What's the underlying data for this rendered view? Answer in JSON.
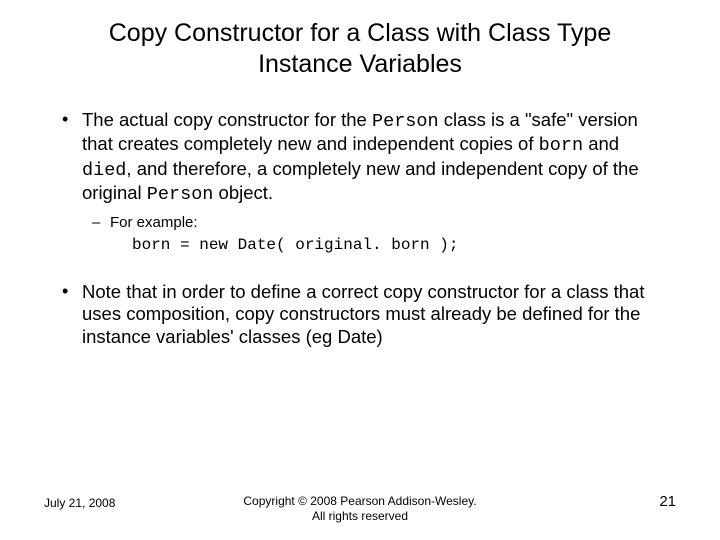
{
  "title": "Copy Constructor for a Class with Class Type Instance Variables",
  "bullets": [
    {
      "pre1": "The actual copy constructor for the ",
      "c1": "Person",
      "mid1": " class is a \"safe\" version that creates completely new and independent copies of ",
      "c2": "born",
      "mid2": " and ",
      "c3": "died",
      "mid3": ", and therefore, a completely new and independent copy of the original ",
      "c4": "Person",
      "post": " object.",
      "sub": {
        "label": "For example:",
        "code": "born = new Date( original. born );"
      }
    },
    {
      "text": "Note that in order to define a correct copy constructor for a class that uses composition, copy constructors must already be defined for the instance variables' classes (eg Date)"
    }
  ],
  "footer": {
    "date": "July 21, 2008",
    "copyright_l1": "Copyright © 2008 Pearson Addison-Wesley.",
    "copyright_l2": "All rights reserved",
    "page": "21"
  }
}
